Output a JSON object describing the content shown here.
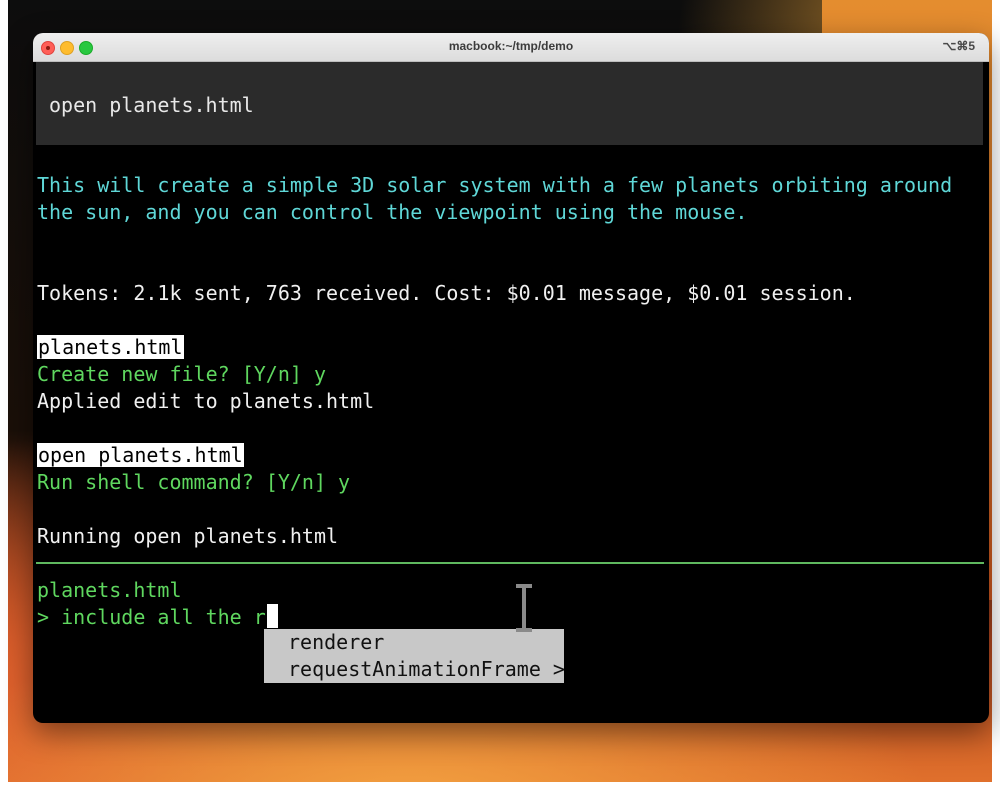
{
  "window": {
    "title": "macbook:~/tmp/demo",
    "shortcut": "⌥⌘5"
  },
  "terminal": {
    "command_block": "open planets.html",
    "assistant_reply_line1": "This will create a simple 3D solar system with a few planets orbiting around",
    "assistant_reply_line2": "the sun, and you can control the viewpoint using the mouse.",
    "tokens_line": "Tokens: 2.1k sent, 763 received. Cost: $0.01 message, $0.01 session.",
    "file_name_1": "planets.html",
    "create_prompt": "Create new file? [Y/n] y",
    "applied_edit": "Applied edit to planets.html",
    "shell_command": "open planets.html",
    "run_prompt": "Run shell command? [Y/n] y",
    "running_line": "Running open planets.html",
    "current_file": "planets.html",
    "input_line": "> include all the r"
  },
  "autocomplete": {
    "items": [
      "renderer",
      "requestAnimationFrame >"
    ]
  },
  "colors": {
    "assistant_text": "#5fd7d7",
    "prompt_text": "#5fd75f",
    "terminal_bg": "#000000"
  }
}
